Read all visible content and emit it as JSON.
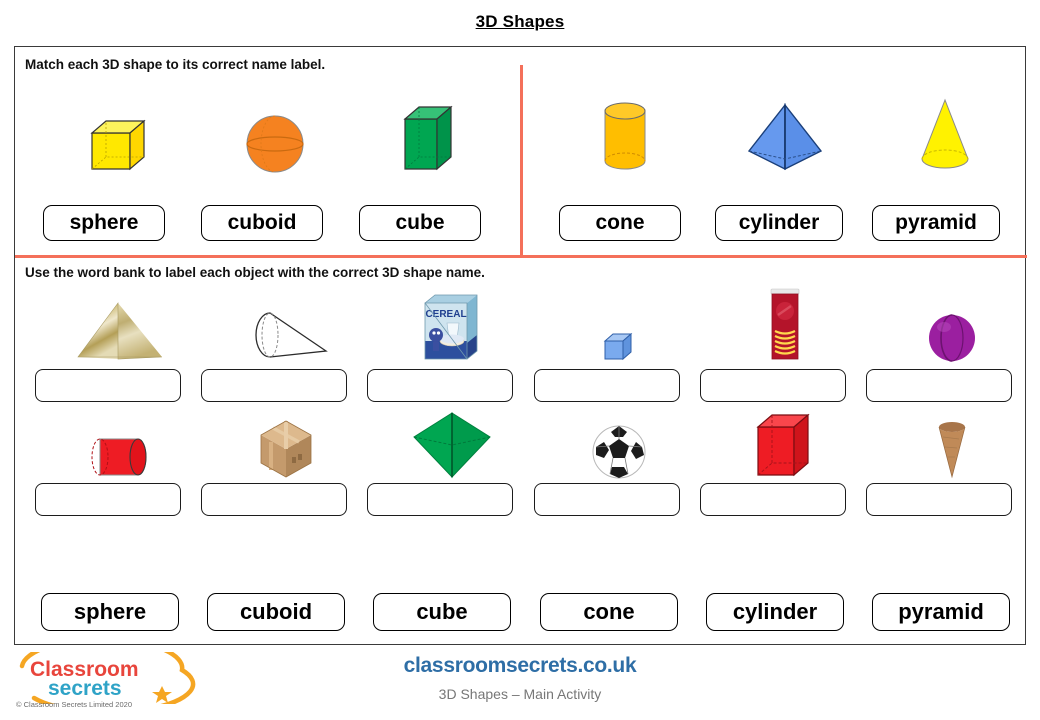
{
  "page": {
    "title": "3D Shapes"
  },
  "section1": {
    "instruction": "Match each 3D shape to its correct name label.",
    "shapes": [
      {
        "icon": "cube-yellow-icon",
        "name": "cube",
        "color": "#ffe800"
      },
      {
        "icon": "sphere-orange-icon",
        "name": "sphere",
        "color": "#f58220"
      },
      {
        "icon": "cuboid-green-icon",
        "name": "cuboid",
        "color": "#00a651"
      },
      {
        "icon": "cylinder-orange-icon",
        "name": "cylinder",
        "color": "#ffbe00"
      },
      {
        "icon": "pyramid-blue-icon",
        "name": "pyramid",
        "color": "#6699ee"
      },
      {
        "icon": "cone-yellow-icon",
        "name": "cone",
        "color": "#fff200"
      }
    ],
    "labels": [
      "sphere",
      "cuboid",
      "cube",
      "cone",
      "cylinder",
      "pyramid"
    ]
  },
  "section2": {
    "instruction": "Use the word bank to label each object with the correct 3D shape name.",
    "rows": [
      [
        {
          "icon": "stone-pyramid-icon",
          "object": "stone pyramid",
          "answer": ""
        },
        {
          "icon": "paper-cone-icon",
          "object": "paper cone",
          "answer": ""
        },
        {
          "icon": "cereal-box-icon",
          "object": "cereal box",
          "answer": ""
        },
        {
          "icon": "blue-dice-cube-icon",
          "object": "blue dice cube",
          "answer": ""
        },
        {
          "icon": "crisps-tube-icon",
          "object": "crisps tube",
          "answer": ""
        },
        {
          "icon": "purple-ball-icon",
          "object": "purple ball",
          "answer": ""
        }
      ],
      [
        {
          "icon": "red-cylinder-icon",
          "object": "red cylinder",
          "answer": ""
        },
        {
          "icon": "cardboard-box-icon",
          "object": "cardboard box",
          "answer": ""
        },
        {
          "icon": "green-pyramid-icon",
          "object": "green pyramid",
          "answer": ""
        },
        {
          "icon": "football-icon",
          "object": "football",
          "answer": ""
        },
        {
          "icon": "red-cuboid-icon",
          "object": "red cuboid",
          "answer": ""
        },
        {
          "icon": "ice-cream-cone-icon",
          "object": "ice cream cone",
          "answer": ""
        }
      ]
    ],
    "word_bank": [
      "sphere",
      "cuboid",
      "cube",
      "cone",
      "cylinder",
      "pyramid"
    ]
  },
  "footer": {
    "logo_line1": "Classroom",
    "logo_line2": "secrets",
    "copyright": "© Classroom Secrets Limited 2020",
    "site_url": "classroomsecrets.co.uk",
    "subtitle": "3D Shapes – Main Activity"
  },
  "colors": {
    "rule": "#f4705a",
    "brand_blue": "#2e6ea6",
    "logo_red": "#e8453c",
    "logo_teal": "#2fa3c7",
    "logo_orange": "#f5a623"
  }
}
